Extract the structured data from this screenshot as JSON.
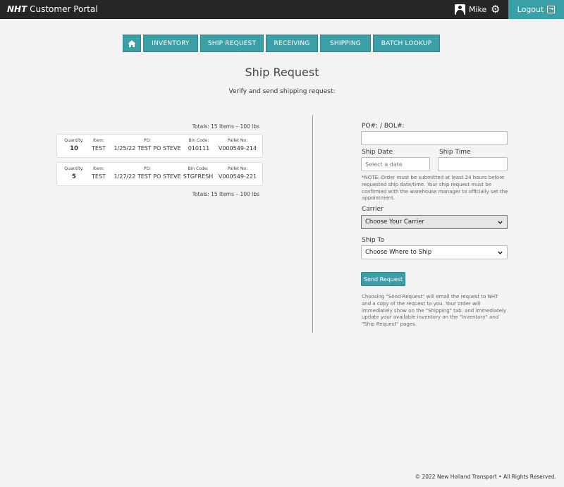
{
  "header": {
    "brand_bold": "NHT",
    "brand_rest": " Customer Portal",
    "user_name": "Mike",
    "logout_label": "Logout"
  },
  "nav": {
    "items": [
      "INVENTORY",
      "SHIP REQUEST",
      "RECEIVING",
      "SHIPPING",
      "BATCH LOOKUP"
    ]
  },
  "page": {
    "title": "Ship Request",
    "subtitle": "Verify and send shipping request:"
  },
  "summary": {
    "totals": "Totals: 15 Items – 100 lbs",
    "labels": {
      "quantity": "Quantity:",
      "item": "Item:",
      "po": "PO:",
      "bin": "Bin Code:",
      "pallet": "Pallet No:"
    },
    "items": [
      {
        "quantity": "10",
        "item": "TEST",
        "po": "1/25/22 TEST PO STEVE",
        "bin": "010111",
        "pallet": "V000549-214"
      },
      {
        "quantity": "5",
        "item": "TEST",
        "po": "1/27/22 TEST PO STEVE",
        "bin": "STGFRESH",
        "pallet": "V000549-221"
      }
    ]
  },
  "form": {
    "po_label": "PO#: / BOL#:",
    "po_value": "",
    "ship_date_label": "Ship Date",
    "ship_date_placeholder": "Select a date",
    "ship_time_label": "Ship Time",
    "ship_time_value": "",
    "note": "*NOTE: Order must be submitted at least 24 hours before requested ship date/time. Your ship request must be confirmed with the warehouse manager to officially set the appointment.",
    "carrier_label": "Carrier",
    "carrier_selected": "Choose Your Carrier",
    "ship_to_label": "Ship To",
    "ship_to_selected": "Choose Where to Ship",
    "send_label": "Send Request",
    "send_note": "Choosing \"Send Request\" will email the request to NHT and a copy of the request to you. Your order will immediately show on the \"Shipping\" tab. and immediately update your available inventory on the \"Inventory\" and \"Ship Request\" pages."
  },
  "footer": {
    "text": "© 2022 New Holland Transport • All Rights Reserved."
  },
  "colors": {
    "accent": "#3a9fa7",
    "topbar": "#262626",
    "background": "#f4f4f4"
  },
  "icons": [
    "user-icon",
    "gear-icon",
    "logout-icon",
    "home-icon",
    "chevron-down-icon"
  ]
}
